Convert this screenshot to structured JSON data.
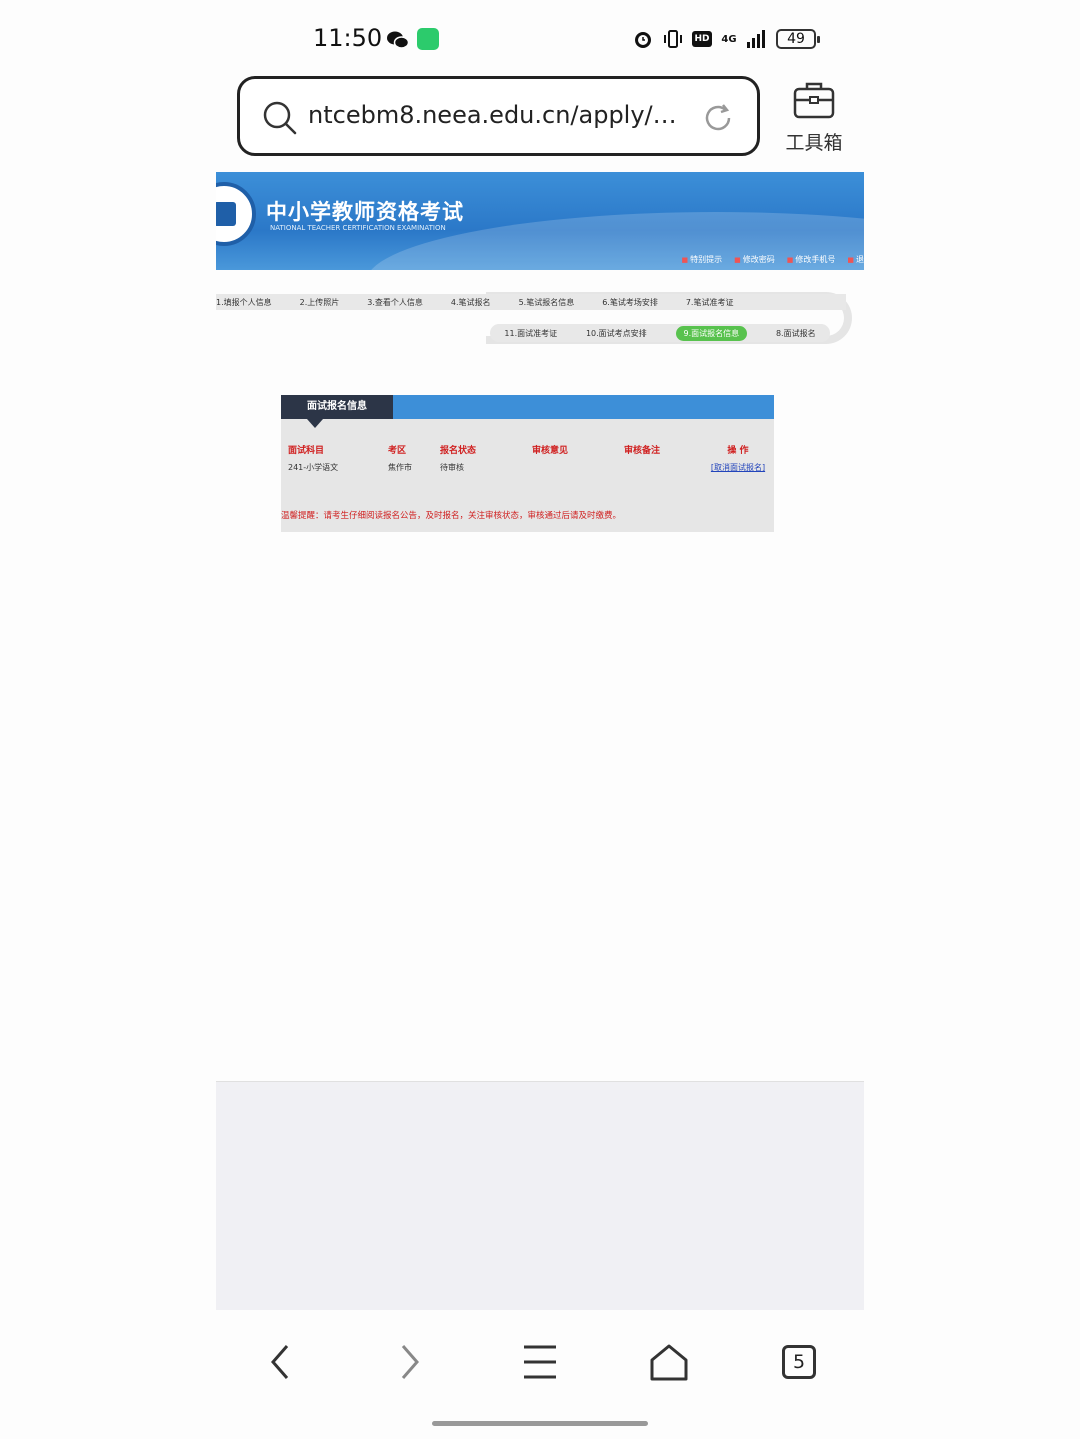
{
  "status_bar": {
    "time": "11:50",
    "network": "4G",
    "hd": "HD",
    "battery": "49"
  },
  "browser": {
    "url": "ntcebm8.neea.edu.cn/apply/m...",
    "toolbox_label": "工具箱",
    "tab_count": "5"
  },
  "site": {
    "title": "中小学教师资格考试",
    "subtitle": "NATIONAL TEACHER CERTIFICATION EXAMINATION",
    "header_links": [
      "特别提示",
      "修改密码",
      "修改手机号",
      "退"
    ]
  },
  "steps": {
    "row1": [
      "1.填报个人信息",
      "2.上传照片",
      "3.查看个人信息",
      "4.笔试报名",
      "5.笔试报名信息",
      "6.笔试考场安排",
      "7.笔试准考证"
    ],
    "row2": [
      "11.面试准考证",
      "10.面试考点安排",
      "9.面试报名信息",
      "8.面试报名"
    ],
    "active": "9.面试报名信息"
  },
  "panel": {
    "tab_label": "面试报名信息",
    "columns": [
      "面试科目",
      "考区",
      "报名状态",
      "审核意见",
      "审核备注",
      "操 作"
    ],
    "rows": [
      {
        "subject": "241-小学语文",
        "area": "焦作市",
        "status": "待审核",
        "opinion": "",
        "remark": "",
        "action": "[取消面试报名]"
      }
    ],
    "notice": "温馨提醒：请考生仔细阅读报名公告，及时报名，关注审核状态，审核通过后请及时缴费。"
  },
  "colors": {
    "banner": "#2b78c8",
    "tab_dark": "#2c3547",
    "header_red": "#d02020",
    "active_step": "#58c24e"
  }
}
